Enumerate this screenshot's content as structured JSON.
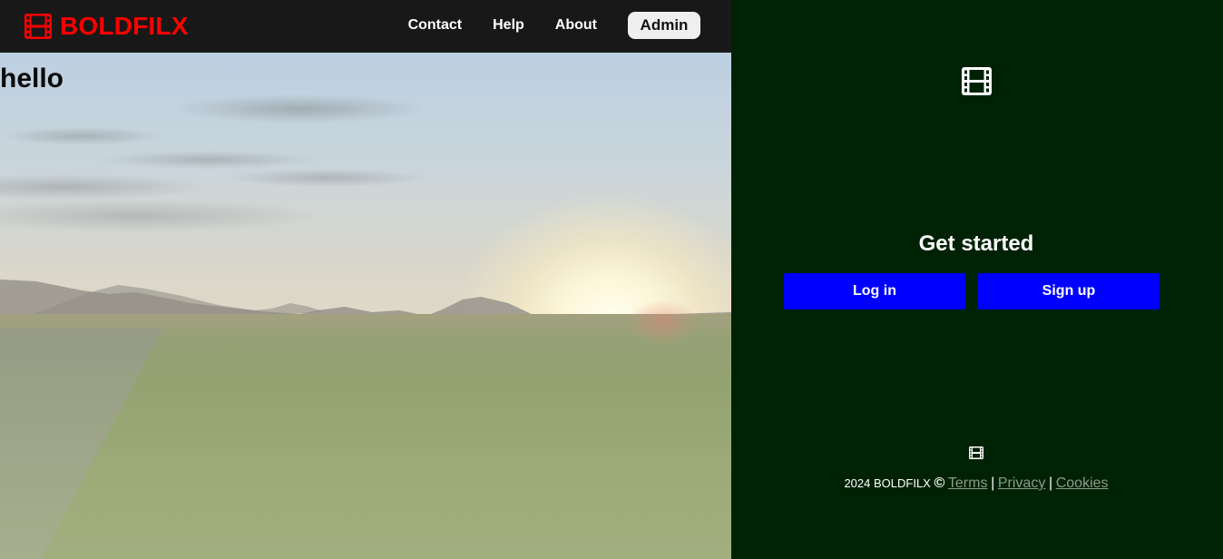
{
  "navbar": {
    "brand": "BOLDFILX",
    "brand_icon": "film-icon",
    "brand_color": "#ff0000",
    "links": [
      "Contact",
      "Help",
      "About"
    ],
    "admin_label": "Admin"
  },
  "hero": {
    "title": "hello",
    "background": "sunset-field-photo"
  },
  "panel": {
    "icon": "film-icon",
    "heading": "Get started",
    "login_label": "Log in",
    "signup_label": "Sign up",
    "button_color": "#0000ff",
    "background_color": "#002204"
  },
  "footer": {
    "icon": "film-icon",
    "text": "2024 BOLDFILX",
    "copyright_symbol": "©",
    "links": [
      "Terms",
      "Privacy",
      "Cookies"
    ],
    "separator": "|"
  }
}
